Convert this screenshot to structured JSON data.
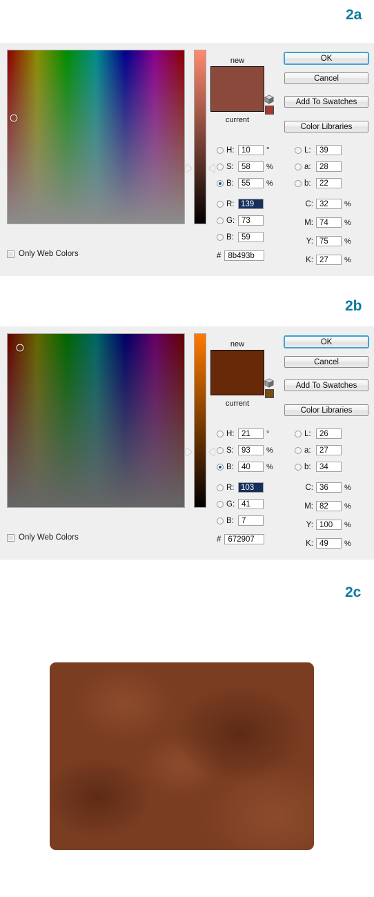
{
  "figures": [
    {
      "label": "2a"
    },
    {
      "label": "2b"
    },
    {
      "label": "2c"
    }
  ],
  "accent_color": "#0b7b9e",
  "dialogs": [
    {
      "id": "color-picker-2a",
      "preview": {
        "new_label": "new",
        "current_label": "current",
        "new_color": "#8b493b",
        "current_color": "#8b493b",
        "gamut_warning_icon": "cube-icon",
        "gamut_swatch_color": "#a33a33"
      },
      "buttons": [
        {
          "name": "ok-button",
          "label": "OK",
          "focused": true
        },
        {
          "name": "cancel-button",
          "label": "Cancel",
          "focused": false
        },
        {
          "name": "add-to-swatches-button",
          "label": "Add To Swatches",
          "focused": false
        },
        {
          "name": "color-libraries-button",
          "label": "Color Libraries",
          "focused": false
        }
      ],
      "only_web_colors": {
        "label": "Only Web Colors",
        "checked": false
      },
      "hsb": [
        {
          "key": "H",
          "label": "H:",
          "value": "10",
          "unit": "°",
          "selected_radio": false,
          "text_selected": false
        },
        {
          "key": "S",
          "label": "S:",
          "value": "58",
          "unit": "%",
          "selected_radio": false,
          "text_selected": false
        },
        {
          "key": "B",
          "label": "B:",
          "value": "55",
          "unit": "%",
          "selected_radio": true,
          "text_selected": false
        }
      ],
      "rgb": [
        {
          "key": "R",
          "label": "R:",
          "value": "139",
          "unit": "",
          "selected_radio": false,
          "text_selected": true
        },
        {
          "key": "G",
          "label": "G:",
          "value": "73",
          "unit": "",
          "selected_radio": false,
          "text_selected": false
        },
        {
          "key": "B",
          "label": "B:",
          "value": "59",
          "unit": "",
          "selected_radio": false,
          "text_selected": false
        }
      ],
      "hex": {
        "prefix": "#",
        "value": "8b493b"
      },
      "lab": [
        {
          "key": "L",
          "label": "L:",
          "value": "39",
          "unit": ""
        },
        {
          "key": "a",
          "label": "a:",
          "value": "28",
          "unit": ""
        },
        {
          "key": "b",
          "label": "b:",
          "value": "22",
          "unit": ""
        }
      ],
      "cmyk": [
        {
          "key": "C",
          "label": "C:",
          "value": "32",
          "unit": "%"
        },
        {
          "key": "M",
          "label": "M:",
          "value": "74",
          "unit": "%"
        },
        {
          "key": "Y",
          "label": "Y:",
          "value": "75",
          "unit": "%"
        },
        {
          "key": "K",
          "label": "K:",
          "value": "27",
          "unit": "%"
        }
      ],
      "field": {
        "marker_x_pct": 3.5,
        "marker_y_pct": 39,
        "brightness_pct": 55,
        "slider_top_color": "#ff8a70",
        "slider_thumb_pct": 45
      }
    },
    {
      "id": "color-picker-2b",
      "preview": {
        "new_label": "new",
        "current_label": "current",
        "new_color": "#672907",
        "current_color": "#672907",
        "gamut_warning_icon": "cube-icon",
        "gamut_swatch_color": "#7a4d14"
      },
      "buttons": [
        {
          "name": "ok-button",
          "label": "OK",
          "focused": true
        },
        {
          "name": "cancel-button",
          "label": "Cancel",
          "focused": false
        },
        {
          "name": "add-to-swatches-button",
          "label": "Add To Swatches",
          "focused": false
        },
        {
          "name": "color-libraries-button",
          "label": "Color Libraries",
          "focused": false
        }
      ],
      "only_web_colors": {
        "label": "Only Web Colors",
        "checked": false
      },
      "hsb": [
        {
          "key": "H",
          "label": "H:",
          "value": "21",
          "unit": "°",
          "selected_radio": false,
          "text_selected": false
        },
        {
          "key": "S",
          "label": "S:",
          "value": "93",
          "unit": "%",
          "selected_radio": false,
          "text_selected": false
        },
        {
          "key": "B",
          "label": "B:",
          "value": "40",
          "unit": "%",
          "selected_radio": true,
          "text_selected": false
        }
      ],
      "rgb": [
        {
          "key": "R",
          "label": "R:",
          "value": "103",
          "unit": "",
          "selected_radio": false,
          "text_selected": true
        },
        {
          "key": "G",
          "label": "G:",
          "value": "41",
          "unit": "",
          "selected_radio": false,
          "text_selected": false
        },
        {
          "key": "B",
          "label": "B:",
          "value": "7",
          "unit": "",
          "selected_radio": false,
          "text_selected": false
        }
      ],
      "hex": {
        "prefix": "#",
        "value": "672907"
      },
      "lab": [
        {
          "key": "L",
          "label": "L:",
          "value": "26",
          "unit": ""
        },
        {
          "key": "a",
          "label": "a:",
          "value": "27",
          "unit": ""
        },
        {
          "key": "b",
          "label": "b:",
          "value": "34",
          "unit": ""
        }
      ],
      "cmyk": [
        {
          "key": "C",
          "label": "C:",
          "value": "36",
          "unit": "%"
        },
        {
          "key": "M",
          "label": "M:",
          "value": "82",
          "unit": "%"
        },
        {
          "key": "Y",
          "label": "Y:",
          "value": "100",
          "unit": "%"
        },
        {
          "key": "K",
          "label": "K:",
          "value": "49",
          "unit": "%"
        }
      ],
      "field": {
        "marker_x_pct": 7,
        "marker_y_pct": 8,
        "brightness_pct": 40,
        "slider_top_color": "#ff7a00",
        "slider_thumb_pct": 60
      }
    }
  ],
  "result_image": {
    "name": "leather-texture-result",
    "base_color": "#7a3d22",
    "dark_blotch": "#5d2b15",
    "light_blotch": "#8d4b2c"
  }
}
